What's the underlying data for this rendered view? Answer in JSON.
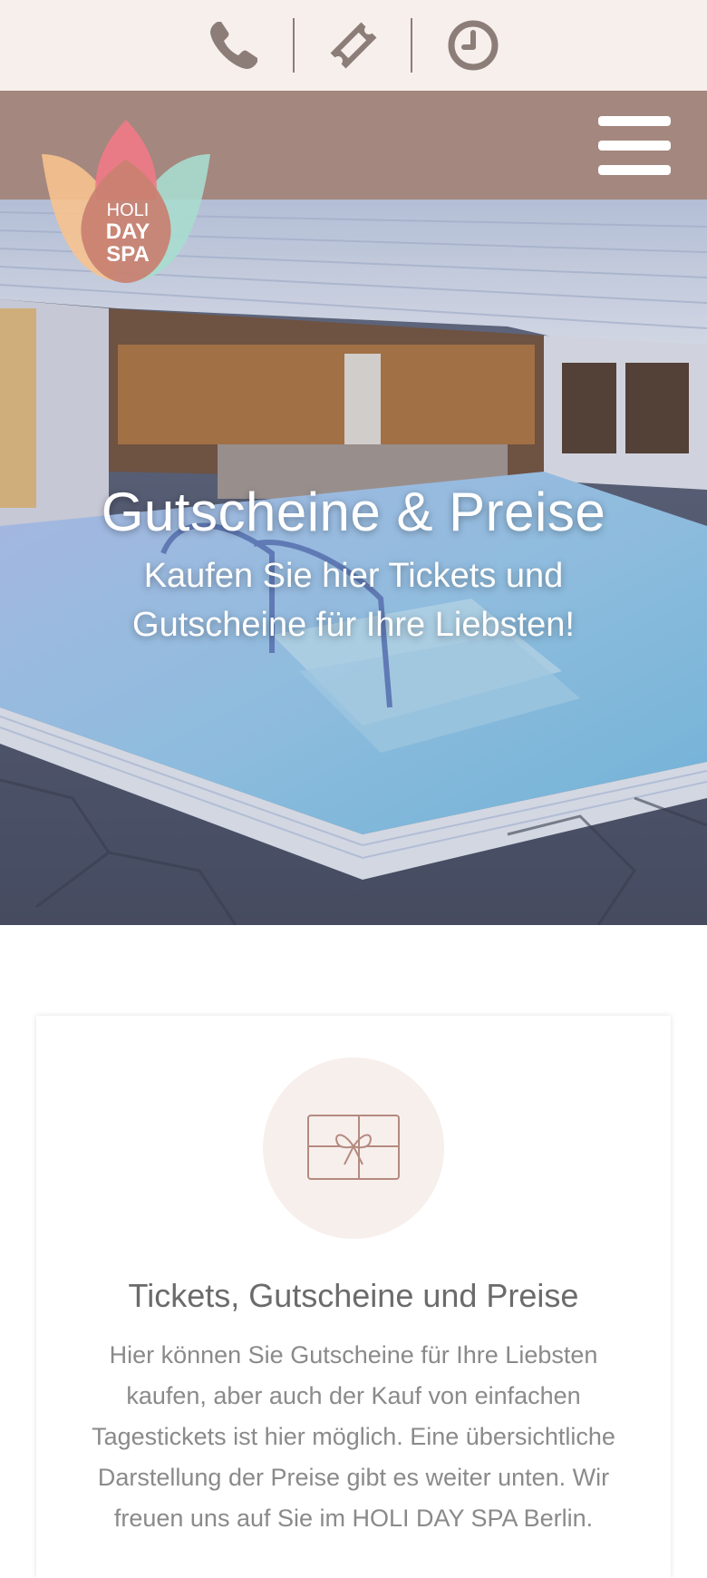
{
  "topbar": {
    "icons": [
      "phone-icon",
      "ticket-icon",
      "clock-icon"
    ]
  },
  "logo": {
    "line1": "HOLI",
    "line2": "DAY",
    "line3": "SPA"
  },
  "hero": {
    "title": "Gutscheine & Preise",
    "subtitle_line1": "Kaufen Sie hier Tickets und",
    "subtitle_line2": "Gutscheine für Ihre Liebsten!"
  },
  "card": {
    "icon": "gift-card-icon",
    "title": "Tickets, Gutscheine und Preise",
    "text": "Hier können Sie Gutscheine für Ihre Liebsten kaufen, aber auch der Kauf von einfachen Tagestickets ist hier möglich. Eine übersichtliche Darstellung der Preise gibt es weiter unten. Wir freuen uns auf Sie im HOLI DAY SPA Berlin."
  },
  "colors": {
    "topbar_bg": "#f7efec",
    "navbar_bg": "#a4877e",
    "icon_color": "#8c7d78",
    "accent": "#b48a80"
  }
}
